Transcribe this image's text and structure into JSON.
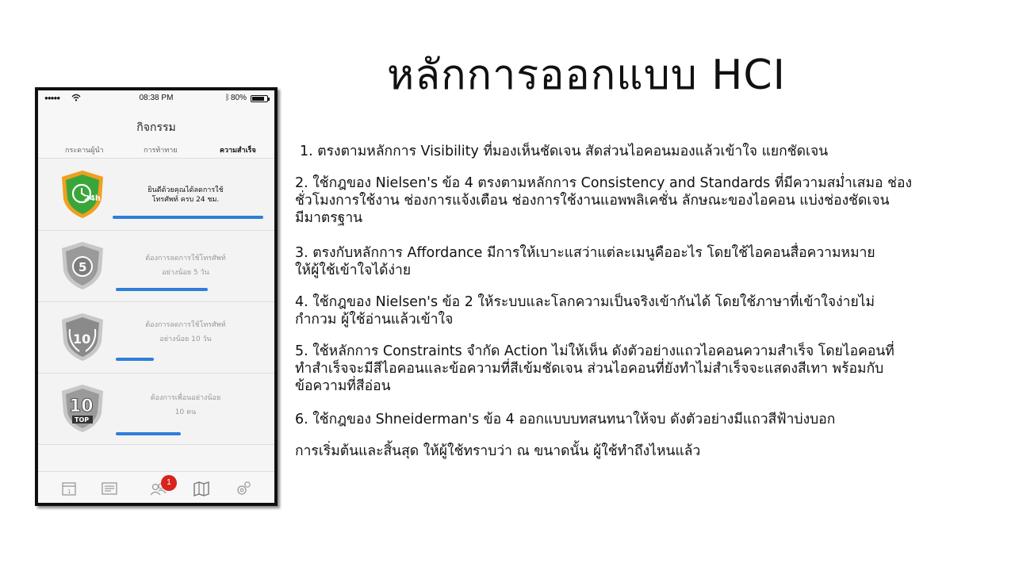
{
  "slide": {
    "title": "หลักการออกแบบ HCI"
  },
  "phone": {
    "status": {
      "signal": "●●●●●",
      "time": "08:38 PM",
      "battery": "80%"
    },
    "nav_title": "กิจกรรม",
    "tabs": [
      {
        "label": "กระดานผู้นำ"
      },
      {
        "label": "การท้าทาย"
      },
      {
        "label": "ความสำเร็จ"
      }
    ],
    "cards": [
      {
        "line1": "ยินดีด้วยคุณได้ลดการใช้",
        "line2": "โทรศัพท์ ครบ 24 ชม.",
        "badge": "24h",
        "state": "done",
        "progress": 1.0
      },
      {
        "line1": "ต้องการลดการใช้โทรศัพท์",
        "line2": "อย่างน้อย 5 วัน",
        "badge": "5",
        "state": "pending",
        "progress": 0.6
      },
      {
        "line1": "ต้องการลดการใช้โทรศัพท์",
        "line2": "อย่างน้อย 10 วัน",
        "badge": "10",
        "state": "pending",
        "progress": 0.25
      },
      {
        "line1": "ต้องการเพื่อนอย่างน้อย",
        "line2": "10 คน",
        "badge": "10",
        "badge_sub": "TOP",
        "state": "pending",
        "progress": 0.42
      }
    ],
    "tabbar": {
      "notification_count": "1",
      "icons": [
        "calendar-icon",
        "news-icon",
        "friends-icon",
        "map-icon",
        "settings-icon"
      ]
    }
  },
  "points": [
    {
      "lines": [
        "1.  ตรงตามหลักการ Visibility ที่มองเห็นชัดเจน สัดส่วนไอคอนมองแล้วเข้าใจ แยกชัดเจน"
      ]
    },
    {
      "lines": [
        "2.  ใช้กฎของ Nielsen's ข้อ 4 ตรงตามหลักการ Consistency and Standards ที่มีความสม่ำเสมอ ช่อง",
        "ชั่วโมงการใช้งาน ช่องการแจ้งเตือน ช่องการใช้งานแอพพลิเคชั่น ลักษณะของไอคอน แบ่งช่องชัดเจน",
        "มีมาตรฐาน"
      ]
    },
    {
      "lines": [
        "3.  ตรงกับหลักการ Affordance มีการให้เบาะแสว่าแต่ละเมนูคืออะไร โดยใช้ไอคอนสื่อความหมาย",
        "ให้ผู้ใช้เข้าใจได้ง่าย"
      ]
    },
    {
      "lines": [
        "4.  ใช้กฎของ Nielsen's ข้อ 2  ให้ระบบและโลกความเป็นจริงเข้ากันได้ โดยใช้ภาษาที่เข้าใจง่ายไม่",
        "กำกวม ผู้ใช้อ่านแล้วเข้าใจ"
      ]
    },
    {
      "lines": [
        "5.  ใช้หลักการ  Constraints จำกัด Action ไม่ให้เห็น ดังตัวอย่างแถวไอคอนความสำเร็จ โดยไอคอนที่",
        "ทำสำเร็จจะมีสีไอคอนและข้อความที่สีเข้มชัดเจน ส่วนไอคอนที่ยังทำไม่สำเร็จจะแสดงสีเทา พร้อมกับ",
        "ข้อความที่สีอ่อน"
      ]
    },
    {
      "lines": [
        "6.  ใช้กฎของ Shneiderman's ข้อ 4 ออกแบบบทสนทนาให้จบ ดังตัวอย่างมีแถวสีฟ้าบ่งบอก"
      ]
    },
    {
      "lines": [
        "การเริ่มต้นและสิ้นสุด ให้ผู้ใช้ทราบว่า ณ ขนาดนั้น ผู้ใช้ทำถึงไหนแล้ว"
      ]
    }
  ],
  "colors": {
    "progress": "#2f7ed8",
    "badge_done_green": "#3aa63a",
    "badge_done_orange": "#f0a020",
    "badge_pending": "#9a9a9a",
    "notification": "#d9231d"
  }
}
